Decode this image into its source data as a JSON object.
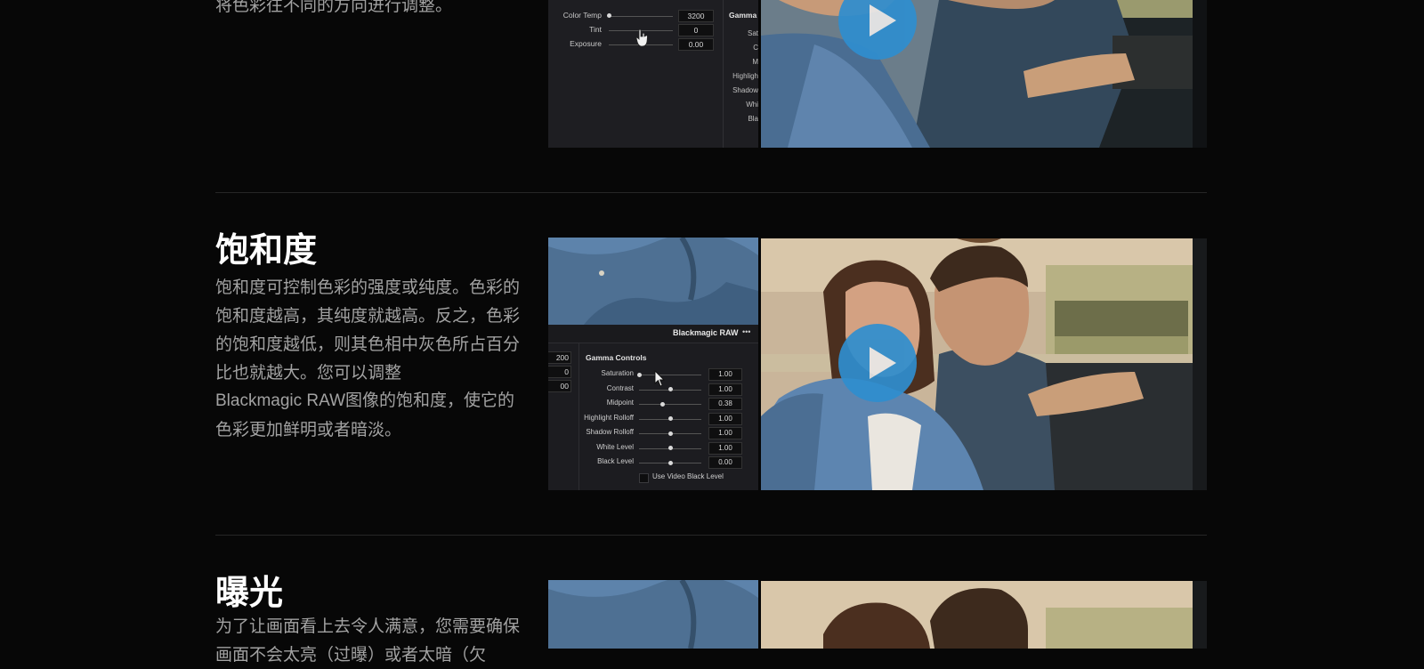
{
  "sections": [
    {
      "id": "white-balance",
      "partial_text": "将色彩往不同的方向进行调整。",
      "panel": {
        "rows": [
          {
            "label": "Color Temp",
            "value": "3200"
          },
          {
            "label": "Tint",
            "value": "0"
          },
          {
            "label": "Exposure",
            "value": "0.00"
          }
        ],
        "side_title": "Gamma",
        "side_labels": [
          "Sat",
          "C",
          "M",
          "Highligh",
          "Shadow",
          "Whi",
          "Bla"
        ]
      }
    },
    {
      "id": "saturation",
      "title": "饱和度",
      "body": [
        "饱和度可控制色彩的强度或纯度。色彩的",
        "饱和度越高，其纯度就越高。反之，色彩",
        "的饱和度越低，则其色相中灰色所占百分",
        "比也就越大。您可以调整",
        "Blackmagic RAW图像的饱和度，使它的",
        "色彩更加鲜明或者暗淡。"
      ],
      "panel": {
        "header": "Blackmagic RAW",
        "header_menu": "•••",
        "left_values": [
          "200",
          "0",
          "00"
        ],
        "group_title": "Gamma Controls",
        "rows": [
          {
            "label": "Saturation",
            "value": "1.00",
            "knob": 0.0
          },
          {
            "label": "Contrast",
            "value": "1.00",
            "knob": 0.5
          },
          {
            "label": "Midpoint",
            "value": "0.38",
            "knob": 0.38
          },
          {
            "label": "Highlight Rolloff",
            "value": "1.00",
            "knob": 0.5
          },
          {
            "label": "Shadow Rolloff",
            "value": "1.00",
            "knob": 0.5
          },
          {
            "label": "White Level",
            "value": "1.00",
            "knob": 0.5
          },
          {
            "label": "Black Level",
            "value": "0.00",
            "knob": 0.5
          }
        ],
        "checkbox_label": "Use Video Black Level"
      }
    },
    {
      "id": "exposure",
      "title": "曝光",
      "body": [
        "为了让画面看上去令人满意，您需要确保",
        "画面不会太亮（过曝）或者太暗（欠"
      ]
    }
  ],
  "colors": {
    "background": "#070707",
    "play_button": "#2f8ecf",
    "text": "#a2a2a2",
    "heading": "#ffffff"
  },
  "icons": [
    "play-icon",
    "mouse-cursor-icon"
  ]
}
